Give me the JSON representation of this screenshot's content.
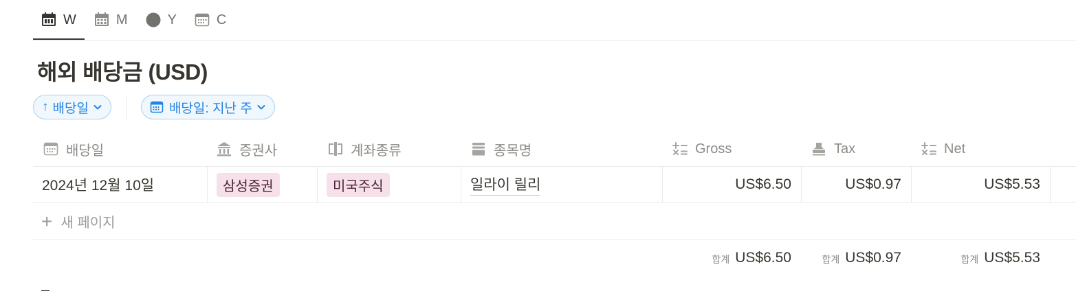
{
  "views": [
    {
      "label": "W",
      "icon": "calendar-week-icon",
      "active": true
    },
    {
      "label": "M",
      "icon": "calendar-month-icon",
      "active": false
    },
    {
      "label": "Y",
      "icon": "circle-icon",
      "active": false
    },
    {
      "label": "C",
      "icon": "calendar-icon",
      "active": false
    }
  ],
  "title": "해외 배당금 (USD)",
  "filters": {
    "sort_label": "배당일",
    "date_filter_label": "배당일: 지난 주"
  },
  "columns": {
    "date": "배당일",
    "broker": "증권사",
    "account_type": "계좌종류",
    "stock_name": "종목명",
    "gross": "Gross",
    "tax": "Tax",
    "net": "Net"
  },
  "rows": [
    {
      "date": "2024년 12월 10일",
      "broker": "삼성증권",
      "account_type": "미국주식",
      "stock_name": "일라이 릴리",
      "gross": "US$6.50",
      "tax": "US$0.97",
      "net": "US$5.53"
    }
  ],
  "new_page_label": "새 페이지",
  "totals": {
    "label": "합계",
    "gross": "US$6.50",
    "tax": "US$0.97",
    "net": "US$5.53"
  },
  "colors": {
    "accent": "#2383e2",
    "tag_bg": "#f6e1ea",
    "text": "#37352f"
  }
}
